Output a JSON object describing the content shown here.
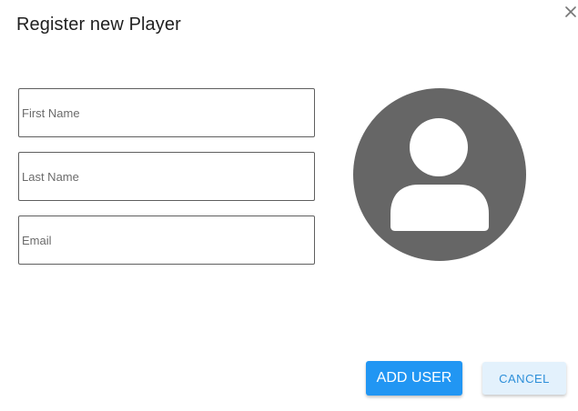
{
  "dialog": {
    "title": "Register new Player",
    "close_icon": "close-icon"
  },
  "form": {
    "first_name": {
      "placeholder": "First Name",
      "value": ""
    },
    "last_name": {
      "placeholder": "Last Name",
      "value": ""
    },
    "email": {
      "placeholder": "Email",
      "value": ""
    }
  },
  "avatar": {
    "icon": "user-avatar-icon",
    "color": "#666666"
  },
  "actions": {
    "add_label": "ADD USER",
    "cancel_label": "CANCEL"
  },
  "colors": {
    "primary": "#2196f3",
    "secondary_bg": "#e3f1fc",
    "secondary_text": "#2d8fd9"
  }
}
